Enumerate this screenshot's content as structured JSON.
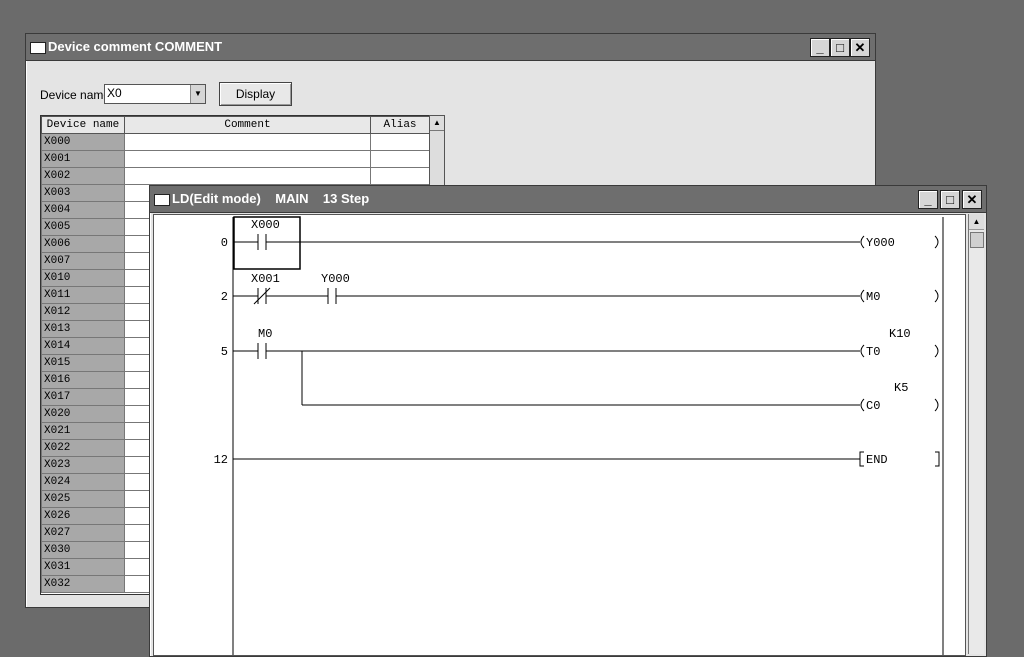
{
  "comment_window": {
    "title": "Device comment COMMENT",
    "device_name_label": "Device name",
    "device_name_value": "X0",
    "display_button": "Display",
    "columns": [
      "Device name",
      "Comment",
      "Alias"
    ],
    "rows": [
      "X000",
      "X001",
      "X002",
      "X003",
      "X004",
      "X005",
      "X006",
      "X007",
      "X010",
      "X011",
      "X012",
      "X013",
      "X014",
      "X015",
      "X016",
      "X017",
      "X020",
      "X021",
      "X022",
      "X023",
      "X024",
      "X025",
      "X026",
      "X027",
      "X030",
      "X031",
      "X032"
    ]
  },
  "ladder_window": {
    "title": "LD(Edit mode)    MAIN    13 Step",
    "rungs": [
      {
        "step": "0"
      },
      {
        "step": "2"
      },
      {
        "step": "5"
      },
      {
        "step": "12"
      }
    ],
    "contacts": {
      "x000": "X000",
      "x001": "X001",
      "y000": "Y000",
      "m0": "M0"
    },
    "coils": {
      "y000": "Y000",
      "m0": "M0",
      "t0": "T0",
      "t0_k": "K10",
      "c0": "C0",
      "c0_k": "K5",
      "end": "END"
    }
  },
  "icons": {
    "minimize": "minimize-icon",
    "maximize": "maximize-icon",
    "close": "close-icon"
  }
}
